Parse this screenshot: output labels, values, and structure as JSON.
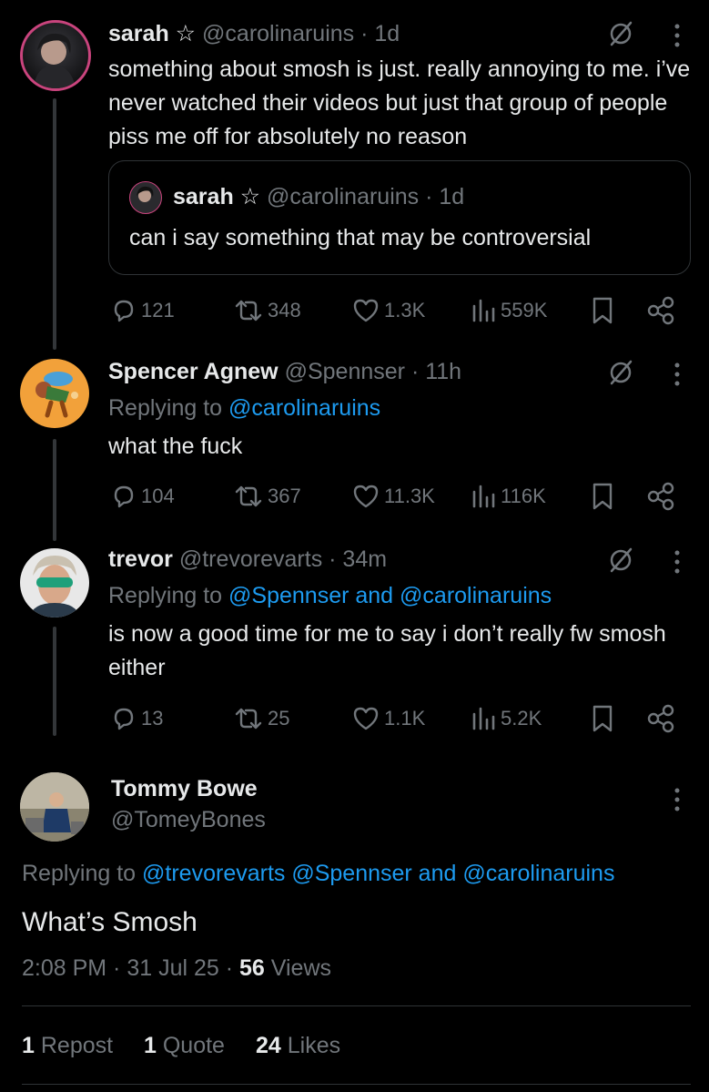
{
  "colors": {
    "background": "#000000",
    "text": "#e7e9ea",
    "muted": "#71767b",
    "link": "#1d9bf0",
    "border": "#2f3336"
  },
  "tweet1": {
    "name": "sarah",
    "star": "☆",
    "handle": "@carolinaruins",
    "time": "· 1d",
    "text": "something about smosh is just. really annoying to me. i’ve never watched their videos but just that group of people piss me off for absolutely no reason",
    "quote": {
      "name": "sarah",
      "star": "☆",
      "handle": "@carolinaruins",
      "time": "· 1d",
      "text": "can i say something that may be controversial"
    },
    "stats": {
      "replies": "121",
      "reposts": "348",
      "likes": "1.3K",
      "views": "559K"
    }
  },
  "tweet2": {
    "name": "Spencer Agnew",
    "handle": "@Spennser",
    "time": "· 11h",
    "replying_label": "Replying to",
    "replying_to": "@carolinaruins",
    "text": "what the fuck",
    "stats": {
      "replies": "104",
      "reposts": "367",
      "likes": "11.3K",
      "views": "116K"
    }
  },
  "tweet3": {
    "name": "trevor",
    "handle": "@trevorevarts",
    "time": "· 34m",
    "replying_label": "Replying to",
    "replying_to": "@Spennser and @carolinaruins",
    "text": "is now a good time for me to say i don’t really fw smosh either",
    "stats": {
      "replies": "13",
      "reposts": "25",
      "likes": "1.1K",
      "views": "5.2K"
    }
  },
  "main_tweet": {
    "name": "Tommy Bowe",
    "handle": "@TomeyBones",
    "replying_label": "Replying to",
    "replying_to": "@trevorevarts @Spennser and @carolinaruins",
    "text": "What’s Smosh",
    "time": "2:08 PM · 31 Jul 25 ·",
    "views_count": "56",
    "views_label": "Views",
    "reposts_count": "1",
    "reposts_label": "Repost",
    "quotes_count": "1",
    "quotes_label": "Quote",
    "likes_count": "24",
    "likes_label": "Likes"
  }
}
